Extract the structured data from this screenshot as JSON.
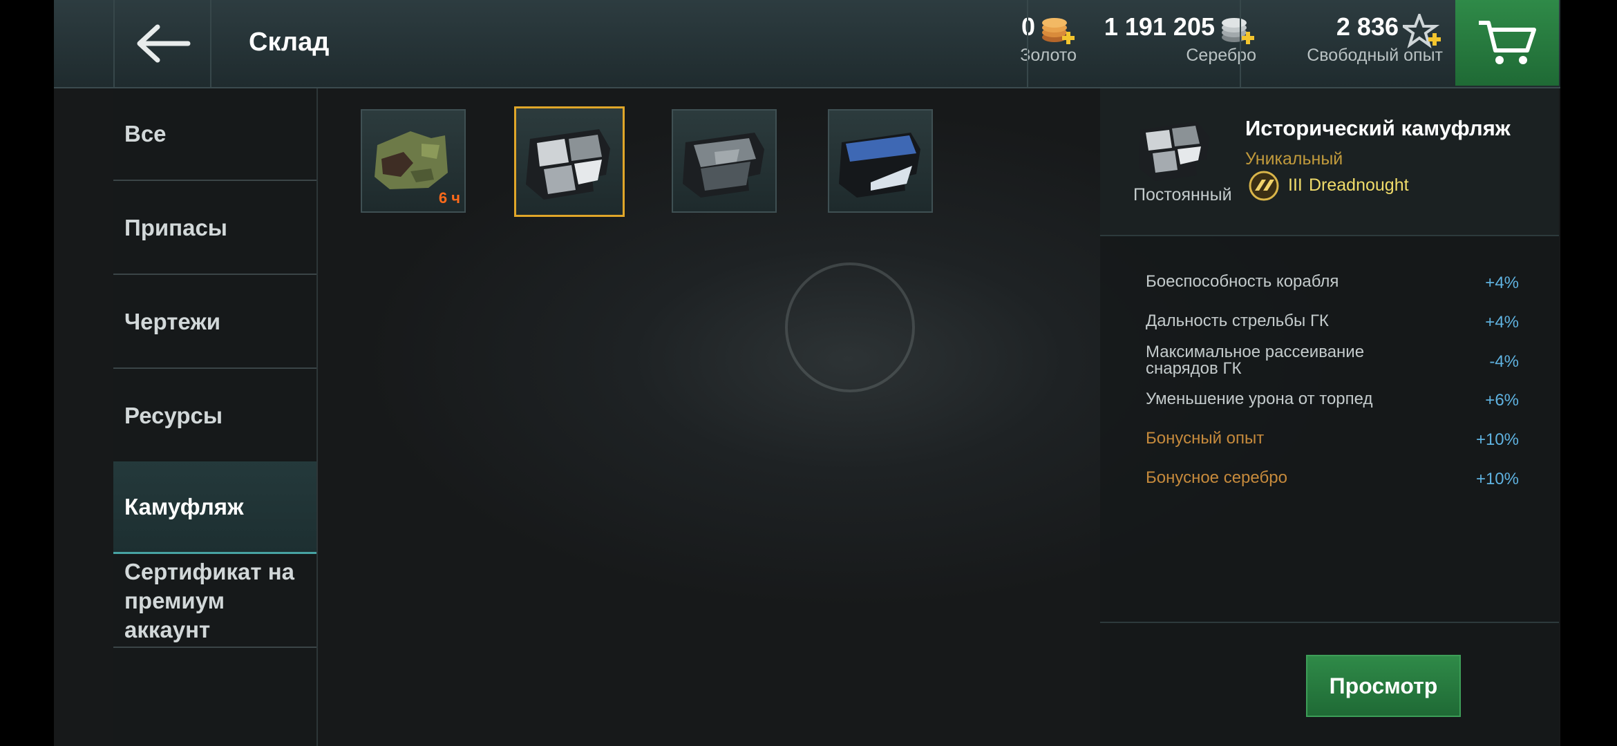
{
  "header": {
    "title": "Склад",
    "gold": {
      "value": "0",
      "label": "Золото",
      "icon": "gold-coins-plus-icon"
    },
    "silver": {
      "value": "1 191 205",
      "label": "Серебро",
      "icon": "silver-coins-plus-icon"
    },
    "free_xp": {
      "value": "2 836",
      "label": "Свободный опыт",
      "icon": "star-plus-icon"
    },
    "cart_icon": "cart-icon",
    "back_icon": "arrow-left-icon"
  },
  "sidebar": {
    "items": [
      {
        "label": "Все"
      },
      {
        "label": "Припасы"
      },
      {
        "label": "Чертежи"
      },
      {
        "label": "Ресурсы"
      },
      {
        "label": "Камуфляж",
        "active": true
      },
      {
        "label": "Сертификат на премиум аккаунт"
      }
    ]
  },
  "items": [
    {
      "name": "camo-item-olive",
      "timer": "6 ч"
    },
    {
      "name": "camo-item-historic",
      "selected": true
    },
    {
      "name": "camo-item-grey"
    },
    {
      "name": "camo-item-blue"
    }
  ],
  "details": {
    "title": "Исторический камуфляж",
    "rarity": "Уникальный",
    "duration": "Постоянный",
    "tier": "III",
    "ship": "Dreadnought",
    "stats": [
      {
        "name": "Боеспособность корабля",
        "value": "+4%"
      },
      {
        "name": "Дальность стрельбы ГК",
        "value": "+4%"
      },
      {
        "name": "Максимальное рассеивание снарядов ГК",
        "value": "-4%"
      },
      {
        "name": "Уменьшение урона от торпед",
        "value": "+6%"
      },
      {
        "name": "Бонусный опыт",
        "value": "+10%",
        "bonus": true
      },
      {
        "name": "Бонусное серебро",
        "value": "+10%",
        "bonus": true
      }
    ],
    "view_button": "Просмотр"
  },
  "colors": {
    "accent_green": "#2f8a48",
    "selected_border": "#e0a629",
    "rarity_gold": "#c19a3c",
    "stat_blue": "#5fb2e0",
    "bonus_orange": "#c68a3c"
  }
}
